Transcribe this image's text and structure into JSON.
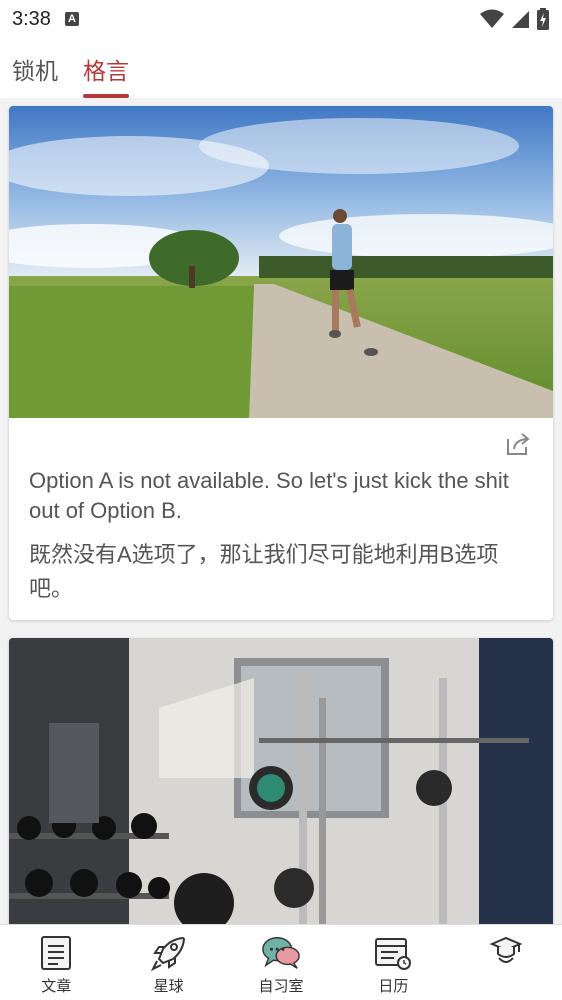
{
  "status": {
    "time": "3:38",
    "notif_letter": "A"
  },
  "tabs": [
    {
      "label": "锁机",
      "active": false
    },
    {
      "label": "格言",
      "active": true
    }
  ],
  "cards": [
    {
      "image": "runner-on-country-road",
      "quote_en": "Option A is not available. So let's just kick the shit out of Option B.",
      "quote_cn": "既然没有A选项了，那让我们尽可能地利用B选项吧。"
    },
    {
      "image": "gym-weights-rack"
    }
  ],
  "nav": [
    {
      "label": "文章",
      "icon": "article-icon"
    },
    {
      "label": "星球",
      "icon": "rocket-icon"
    },
    {
      "label": "自习室",
      "icon": "chat-bubbles-icon"
    },
    {
      "label": "日历",
      "icon": "calendar-icon"
    },
    {
      "label": "",
      "icon": "graduate-icon"
    }
  ],
  "colors": {
    "accent": "#b03a3a"
  }
}
